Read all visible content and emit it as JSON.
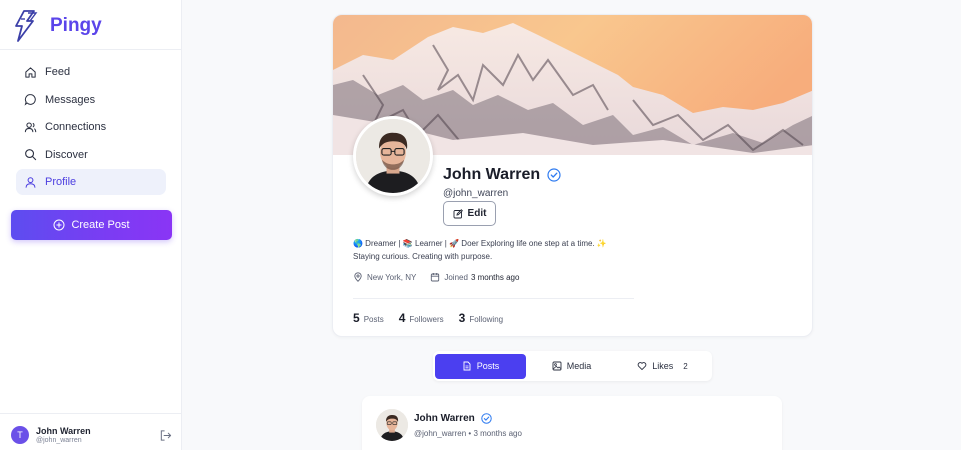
{
  "app": {
    "name": "Pingy",
    "accent": "#5b45ea"
  },
  "sidebar": {
    "items": [
      {
        "label": "Feed",
        "icon": "home-icon"
      },
      {
        "label": "Messages",
        "icon": "message-circle-icon"
      },
      {
        "label": "Connections",
        "icon": "users-icon"
      },
      {
        "label": "Discover",
        "icon": "search-icon"
      },
      {
        "label": "Profile",
        "icon": "user-icon",
        "active": true
      }
    ],
    "create_post_label": "Create Post",
    "user": {
      "initial": "T",
      "name": "John Warren",
      "handle": "@john_warren"
    }
  },
  "profile": {
    "name": "John Warren",
    "handle": "@john_warren",
    "edit_label": "Edit",
    "bio_line1": "🌎 Dreamer | 📚 Learner | 🚀 Doer Exploring life one step at a time. ✨",
    "bio_line2": "Staying curious. Creating with purpose.",
    "location": "New York, NY",
    "joined_label": "Joined",
    "joined_value": "3 months ago",
    "stats": {
      "posts_count": "5",
      "posts_label": "Posts",
      "followers_count": "4",
      "followers_label": "Followers",
      "following_count": "3",
      "following_label": "Following"
    }
  },
  "tabs": {
    "posts": "Posts",
    "media": "Media",
    "likes": "Likes",
    "likes_count": "2"
  },
  "post": {
    "author": "John Warren",
    "handle": "@john_warren",
    "separator": "•",
    "time": "3 months ago"
  }
}
